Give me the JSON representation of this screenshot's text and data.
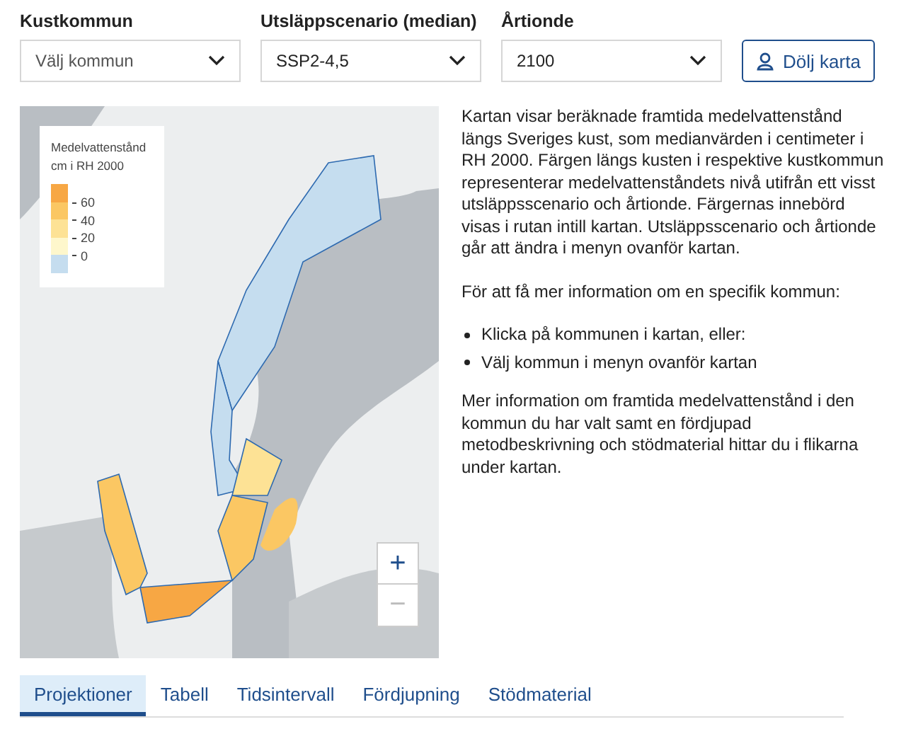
{
  "filters": [
    {
      "label": "Kustkommun",
      "value": "Välj kommun",
      "placeholder_shown": true
    },
    {
      "label": "Utsläppscenario (median)",
      "value": "SSP2-4,5",
      "placeholder_shown": false
    },
    {
      "label": "Årtionde",
      "value": "2100",
      "placeholder_shown": false
    }
  ],
  "toggle_button": {
    "label": "Dölj karta"
  },
  "map": {
    "legend": {
      "title": "Medelvattenstånd",
      "subtitle": "cm i RH 2000",
      "swatches": [
        {
          "color": "#f7a744"
        },
        {
          "color": "#fbc763"
        },
        {
          "color": "#fde295"
        },
        {
          "color": "#fef7cc"
        },
        {
          "color": "#c5ddef"
        }
      ],
      "labels": [
        "60",
        "40",
        "20",
        "0"
      ]
    },
    "zoom": {
      "in": "+",
      "out": "−"
    }
  },
  "description": {
    "paragraphs": [
      "Kartan visar beräknade framtida medelvattenstånd längs Sveriges kust, som medianvärden i centimeter i RH 2000. Färgen längs kusten i respektive kustkommun representerar medelvattenståndets nivå utifrån ett visst utsläppsscenario och årtionde. Färgernas innebörd visas i rutan intill kartan. Utsläppsscenario och årtionde går att ändra i menyn ovanför kartan.",
      "För att få mer information om en specifik kommun:"
    ],
    "bullets": [
      "Klicka på kommunen i kartan, eller:",
      "Välj kommun i menyn ovanför kartan"
    ],
    "footer": "Mer information om framtida medelvattenstånd i den kommun du har valt samt en fördjupad metodbeskrivning och stödmaterial hittar du i flikarna under kartan."
  },
  "tabs": [
    {
      "label": "Projektioner",
      "selected": true
    },
    {
      "label": "Tabell",
      "selected": false
    },
    {
      "label": "Tidsintervall",
      "selected": false
    },
    {
      "label": "Fördjupning",
      "selected": false
    },
    {
      "label": "Stödmaterial",
      "selected": false
    }
  ]
}
